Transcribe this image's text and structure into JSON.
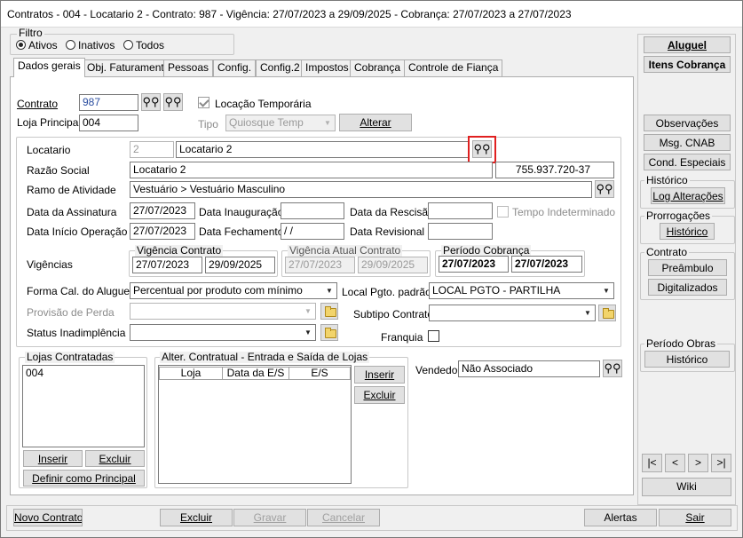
{
  "window": {
    "title": "Contratos - 004 - Locatario 2 - Contrato: 987 - Vigência: 27/07/2023 a 29/09/2025 - Cobrança: 27/07/2023 a 27/07/2023"
  },
  "filter": {
    "title": "Filtro",
    "options": [
      "Ativos",
      "Inativos",
      "Todos"
    ],
    "selected": "Ativos"
  },
  "tabs": [
    "Dados gerais",
    "Obj. Faturamento",
    "Pessoas",
    "Config.",
    "Config.2",
    "Impostos",
    "Cobrança",
    "Controle de Fiança"
  ],
  "active_tab": "Dados gerais",
  "contrato": {
    "label": "Contrato",
    "value": "987",
    "loja_label": "Loja Principal",
    "loja_value": "004",
    "locacao_label": "Locação Temporária",
    "locacao_checked": true,
    "tipo_label": "Tipo",
    "tipo_value": "Quiosque Temp",
    "alterar": "Alterar"
  },
  "locatario": {
    "label": "Locatario",
    "code": "2",
    "name": "Locatario 2"
  },
  "razao": {
    "label": "Razão Social",
    "value": "Locatario 2",
    "doc": "755.937.720-37"
  },
  "ramo": {
    "label": "Ramo de Atividade",
    "value": "Vestuário > Vestuário Masculino"
  },
  "datas": {
    "assinatura_label": "Data da Assinatura",
    "assinatura": "27/07/2023",
    "inauguracao_label": "Data Inauguração",
    "inauguracao": "",
    "rescisao_label": "Data da Rescisão",
    "rescisao": "",
    "tempo_label": "Tempo Indeterminado",
    "inicio_label": "Data Início Operação",
    "inicio": "27/07/2023",
    "fechamento_label": "Data Fechamento",
    "fechamento": " / /",
    "revisional_label": "Data Revisional",
    "revisional": ""
  },
  "vigencias": {
    "label": "Vigências",
    "contrato_title": "Vigência Contrato",
    "contrato_inicio": "27/07/2023",
    "contrato_fim": "29/09/2025",
    "atual_title": "Vigência Atual Contrato",
    "atual_inicio": "27/07/2023",
    "atual_fim": "29/09/2025",
    "cobranca_title": "Período Cobrança",
    "cobranca_inicio": "27/07/2023",
    "cobranca_fim": "27/07/2023"
  },
  "forma": {
    "label": "Forma Cal. do Aluguel",
    "value": "Percentual por produto com mínimo",
    "local_label": "Local Pgto. padrão",
    "local_value": "LOCAL PGTO - PARTILHA"
  },
  "provisao": {
    "label": "Provisão de Perda",
    "value": "",
    "subtipo_label": "Subtipo Contrato",
    "subtipo_value": ""
  },
  "status": {
    "label": "Status Inadimplência",
    "value": "",
    "franquia_label": "Franquia"
  },
  "lojas": {
    "title": "Lojas Contratadas",
    "items": [
      "004"
    ],
    "inserir": "Inserir",
    "excluir": "Excluir",
    "definir": "Definir como Principal"
  },
  "alter": {
    "title": "Alter. Contratual - Entrada e Saída de Lojas",
    "columns": [
      "Loja",
      "Data da E/S",
      "E/S"
    ],
    "inserir": "Inserir",
    "excluir": "Excluir"
  },
  "vendedor": {
    "label": "Vendedor",
    "value": "Não Associado"
  },
  "side": {
    "aluguel": "Aluguel",
    "itens": "Itens Cobrança",
    "observacoes": "Observações",
    "msg": "Msg. CNAB",
    "cond": "Cond. Especiais",
    "historico_title": "Histórico",
    "log": "Log Alterações",
    "prorrog_title": "Prorrogações",
    "prorrog_hist": "Histórico",
    "contrato_title": "Contrato",
    "preambulo": "Preâmbulo",
    "digitalizados": "Digitalizados",
    "obras_title": "Período Obras",
    "obras_hist": "Histórico",
    "nav": [
      "|<",
      "<",
      ">",
      ">|"
    ],
    "wiki": "Wiki"
  },
  "bottom": {
    "novo": "Novo Contrato",
    "excluir": "Excluir",
    "gravar": "Gravar",
    "cancelar": "Cancelar",
    "alertas": "Alertas",
    "sair": "Sair"
  }
}
